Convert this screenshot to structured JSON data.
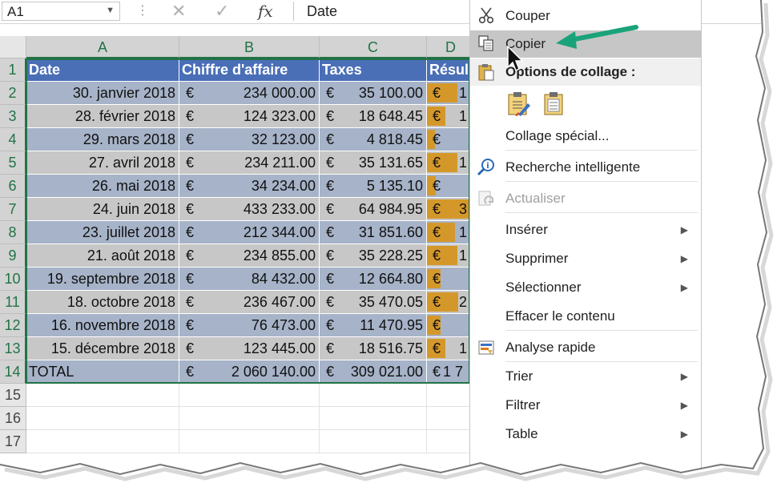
{
  "formula_bar": {
    "name_box": "A1",
    "formula": "Date",
    "fx_label": "fx"
  },
  "columns": [
    "A",
    "B",
    "C",
    "D"
  ],
  "rows": [
    "1",
    "2",
    "3",
    "4",
    "5",
    "6",
    "7",
    "8",
    "9",
    "10",
    "11",
    "12",
    "13",
    "14",
    "15",
    "16",
    "17"
  ],
  "table": {
    "headers": [
      "Date",
      "Chiffre d'affaire",
      "Taxes",
      "Résul"
    ],
    "currency": "€",
    "rows": [
      {
        "date": "30. janvier 2018",
        "ca": "234 000.00",
        "tax": "35 100.00",
        "res": "1"
      },
      {
        "date": "28. février 2018",
        "ca": "124 323.00",
        "tax": "18 648.45",
        "res": "1"
      },
      {
        "date": "29. mars 2018",
        "ca": "32 123.00",
        "tax": "4 818.45",
        "res": ""
      },
      {
        "date": "27. avril 2018",
        "ca": "234 211.00",
        "tax": "35 131.65",
        "res": "1"
      },
      {
        "date": "26. mai 2018",
        "ca": "34 234.00",
        "tax": "5 135.10",
        "res": ""
      },
      {
        "date": "24. juin 2018",
        "ca": "433 233.00",
        "tax": "64 984.95",
        "res": "3"
      },
      {
        "date": "23. juillet 2018",
        "ca": "212 344.00",
        "tax": "31 851.60",
        "res": "1"
      },
      {
        "date": "21. août 2018",
        "ca": "234 855.00",
        "tax": "35 228.25",
        "res": "1"
      },
      {
        "date": "19. septembre 2018",
        "ca": "84 432.00",
        "tax": "12 664.80",
        "res": ""
      },
      {
        "date": "18. octobre 2018",
        "ca": "236 467.00",
        "tax": "35 470.05",
        "res": "2"
      },
      {
        "date": "16. novembre 2018",
        "ca": "76 473.00",
        "tax": "11 470.95",
        "res": ""
      },
      {
        "date": "15. décembre 2018",
        "ca": "123 445.00",
        "tax": "18 516.75",
        "res": "1"
      }
    ],
    "total": {
      "label": "TOTAL",
      "ca": "2 060 140.00",
      "tax": "309 021.00",
      "res": "1 7"
    },
    "databar_fraction": [
      0.54,
      0.29,
      0.07,
      0.54,
      0.08,
      1.0,
      0.49,
      0.54,
      0.19,
      0.55,
      0.18,
      0.28
    ]
  },
  "context_menu": {
    "items": [
      {
        "label": "Couper",
        "icon": "scissors-icon"
      },
      {
        "label": "Copier",
        "icon": "copy-icon",
        "highlighted": true
      },
      {
        "label": "Options de collage :",
        "icon": "paste-icon",
        "section": true
      },
      {
        "label": "Collage spécial...",
        "icon": ""
      },
      {
        "label": "Recherche intelligente",
        "icon": "smart-lookup-icon"
      },
      {
        "label": "Actualiser",
        "icon": "refresh-icon",
        "disabled": true
      },
      {
        "label": "Insérer",
        "icon": "",
        "submenu": true
      },
      {
        "label": "Supprimer",
        "icon": "",
        "submenu": true
      },
      {
        "label": "Sélectionner",
        "icon": "",
        "submenu": true
      },
      {
        "label": "Effacer le contenu",
        "icon": ""
      },
      {
        "label": "Analyse rapide",
        "icon": "quick-analysis-icon"
      },
      {
        "label": "Trier",
        "icon": "",
        "submenu": true
      },
      {
        "label": "Filtrer",
        "icon": "",
        "submenu": true
      },
      {
        "label": "Table",
        "icon": "",
        "submenu": true
      }
    ]
  },
  "colors": {
    "header_blue": "#4a6fb7",
    "band_blue": "#a6b3c8",
    "band_gray": "#c7c7c7",
    "databar_orange": "#d4982a",
    "excel_green": "#217346",
    "annotation_arrow": "#1aa37a"
  }
}
